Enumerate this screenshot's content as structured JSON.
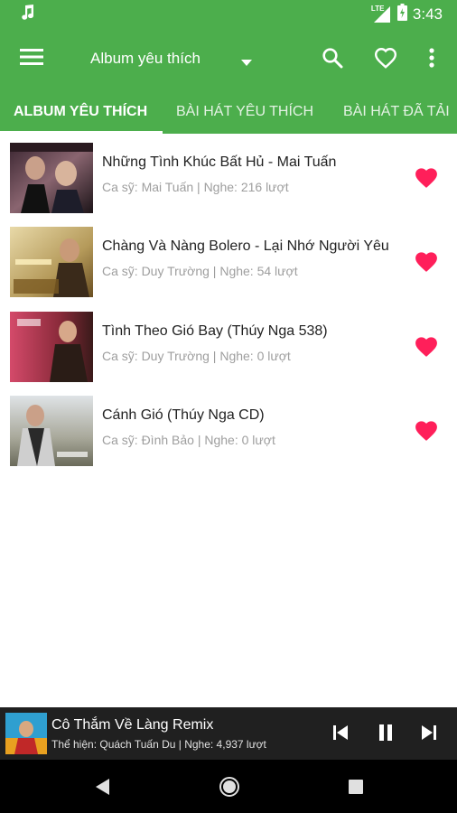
{
  "status_bar": {
    "signal_label": "LTE",
    "time": "3:43"
  },
  "app_bar": {
    "title": "Album yêu thích"
  },
  "tabs": [
    {
      "label": "ALBUM YÊU THÍCH",
      "active": true
    },
    {
      "label": "BÀI HÁT YÊU THÍCH",
      "active": false
    },
    {
      "label": "BÀI HÁT ĐÃ TẢI",
      "active": false
    }
  ],
  "albums": [
    {
      "title": "Những Tình Khúc Bất Hủ - Mai Tuấn",
      "subtitle": "Ca sỹ: Mai Tuấn | Nghe: 216 lượt"
    },
    {
      "title": "Chàng Và Nàng Bolero - Lại Nhớ Người Yêu",
      "subtitle": "Ca sỹ: Duy Trường | Nghe: 54 lượt"
    },
    {
      "title": "Tình Theo Gió Bay (Thúy Nga 538)",
      "subtitle": "Ca sỹ: Duy Trường | Nghe: 0 lượt"
    },
    {
      "title": "Cánh Gió (Thúy Nga CD)",
      "subtitle": "Ca sỹ: Đình Bảo | Nghe: 0 lượt"
    }
  ],
  "player": {
    "title": "Cô Thắm Về Làng Remix",
    "subtitle": "Thể hiện: Quách Tuấn Du | Nghe: 4,937 lượt"
  },
  "colors": {
    "primary": "#4cae4c",
    "heart": "#ff1f5a",
    "player_bg": "#202020"
  },
  "icons": [
    "music-note-icon",
    "signal-icon",
    "battery-icon",
    "menu-icon",
    "dropdown-icon",
    "search-icon",
    "heart-outline-icon",
    "more-vert-icon",
    "heart-filled-icon",
    "skip-previous-icon",
    "pause-icon",
    "skip-next-icon",
    "back-icon",
    "home-icon",
    "recents-icon"
  ]
}
